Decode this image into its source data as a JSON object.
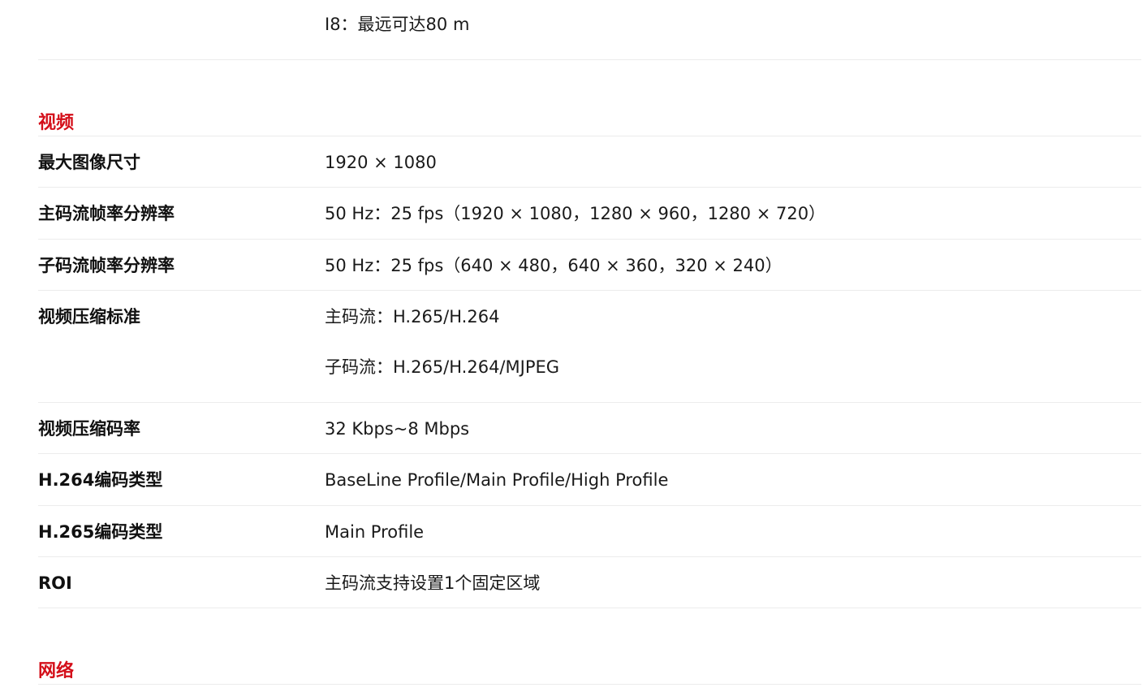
{
  "colors": {
    "section_title": "#d40f1a",
    "divider": "#ececec",
    "label_text": "#111111",
    "value_text": "#1a1a1a"
  },
  "top_row": {
    "value": "I8：最远可达80 m"
  },
  "video_section": {
    "title": "视频",
    "rows": [
      {
        "label": "最大图像尺寸",
        "values": [
          "1920 × 1080"
        ]
      },
      {
        "label": "主码流帧率分辨率",
        "values": [
          "50 Hz：25 fps（1920 × 1080，1280 × 960，1280 × 720）"
        ]
      },
      {
        "label": "子码流帧率分辨率",
        "values": [
          "50 Hz：25 fps（640 × 480，640 × 360，320 × 240）"
        ]
      },
      {
        "label": "视频压缩标准",
        "values": [
          "主码流：H.265/H.264",
          "子码流：H.265/H.264/MJPEG"
        ]
      },
      {
        "label": "视频压缩码率",
        "values": [
          "32 Kbps~8 Mbps"
        ]
      },
      {
        "label": "H.264编码类型",
        "values": [
          "BaseLine Profile/Main Profile/High Profile"
        ]
      },
      {
        "label": "H.265编码类型",
        "values": [
          "Main Profile"
        ]
      },
      {
        "label": "ROI",
        "values": [
          "主码流支持设置1个固定区域"
        ]
      }
    ]
  },
  "network_section": {
    "title": "网络"
  }
}
